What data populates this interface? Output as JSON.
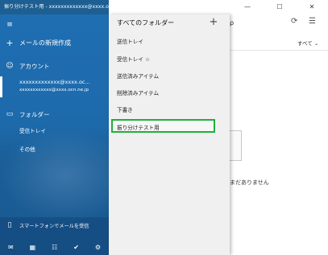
{
  "window": {
    "title": "振り分けテスト用 - xxxxxxxxxxxxx@xxxx.oc...",
    "minimize_icon": "minimize-icon",
    "maximize_icon": "maximize-icon",
    "close_icon": "close-icon"
  },
  "nav": {
    "hamburger_icon": "hamburger-icon",
    "new_mail": "メールの新規作成",
    "accounts_label": "アカウント",
    "account_name": "xxxxxxxxxxxxx@xxxx.oc...",
    "account_email": "xxxxxxxxxxxx@xxxx.ocn.ne.jp",
    "folders_label": "フォルダー",
    "inbox": "受信トレイ",
    "other": "その他",
    "phone_promo": "スマートフォンでメールを受信"
  },
  "folders": {
    "header": "すべてのフォルダー",
    "add": "+",
    "items": [
      "送信トレイ",
      "受信トレイ ☆",
      "送信済みアイテム",
      "削除済みアイテム",
      "下書き",
      "振り分けテスト用"
    ],
    "selected": "振り分けテスト用",
    "highlight_color": "#1fae3d"
  },
  "main": {
    "filter": "すべて ⌄",
    "empty_message": "まだありません"
  },
  "colors": {
    "accent": "#1e6bae",
    "title_bar": "#1e5f93"
  }
}
